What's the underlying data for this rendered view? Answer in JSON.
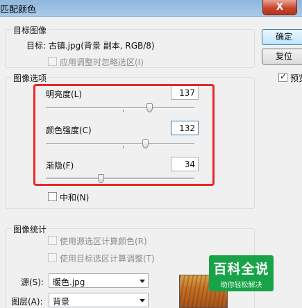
{
  "window": {
    "title": "匹配颜色",
    "close_label": "X"
  },
  "target_group": {
    "label": "目标图像",
    "target_text": "目标: 古镇.jpg(背景 副本, RGB/8)",
    "ignore_selection_label": "应用调整时忽略选区(I)"
  },
  "image_options": {
    "label": "图像选项",
    "luminance": {
      "label": "明亮度(L)",
      "value": "137",
      "position": 0.7
    },
    "intensity": {
      "label": "颜色强度(C)",
      "value": "132",
      "position": 0.66
    },
    "fade": {
      "label": "渐隐(F)",
      "value": "34",
      "position": 0.34
    },
    "neutralize_label": "中和(N)"
  },
  "statistics": {
    "label": "图像统计",
    "use_source_selection_label": "使用源选区计算颜色(R)",
    "use_target_selection_label": "使用目标选区计算调整(T)",
    "source_label": "源(S):",
    "source_value": "暖色.jpg",
    "layer_label": "图层(A):",
    "layer_value": "背景"
  },
  "buttons": {
    "ok": "确定",
    "reset": "复位"
  },
  "preview": {
    "label": "预览",
    "checked": true
  },
  "watermark": {
    "title": "百科全说",
    "subtitle": "助你轻松解决"
  },
  "colors": {
    "highlight": "#e8262a",
    "watermark_bg": "#19a349",
    "titlebar": "#a9c9e8"
  }
}
